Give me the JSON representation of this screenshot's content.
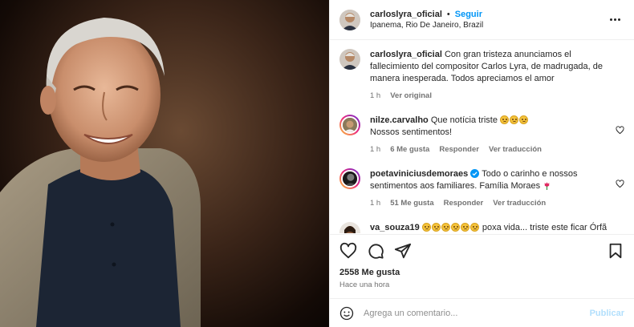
{
  "post": {
    "author": "carloslyra_oficial",
    "follow_label": "Seguir",
    "location": "Ipanema, Rio De Janeiro, Brazil",
    "more_icon": "more-horizontal-icon"
  },
  "caption": {
    "user": "carloslyra_oficial",
    "text": "Con gran tristeza anunciamos el fallecimiento del compositor Carlos Lyra, de madrugada, de manera inesperada. Todos apreciamos el amor",
    "time": "1 h",
    "see_original": "Ver original"
  },
  "comments": [
    {
      "user": "nilze.carvalho",
      "line1": "Que notícia triste",
      "line2": "Nossos sentimentos!",
      "time": "1 h",
      "likes": "6 Me gusta",
      "reply": "Responder",
      "translate": "Ver traducción"
    },
    {
      "user": "poetaviniciusdemoraes",
      "text": "Todo o carinho e nossos sentimentos aos familiares. Família Moraes",
      "time": "1 h",
      "likes": "51 Me gusta",
      "reply": "Responder",
      "translate": "Ver traducción"
    },
    {
      "user": "va_souza19",
      "text": "poxa vida... triste este ficar Órfã de Grandes da Nossa Musica... chora por quem se foi e chora"
    }
  ],
  "likes_count": "2558 Me gusta",
  "posted_time": "Hace una hora",
  "composer": {
    "placeholder": "Agrega un comentario...",
    "publish_label": "Publicar"
  },
  "colors": {
    "accent": "#0095f6",
    "publish_disabled": "#b2dffc",
    "muted": "#737373",
    "verified": "#0095f6"
  }
}
